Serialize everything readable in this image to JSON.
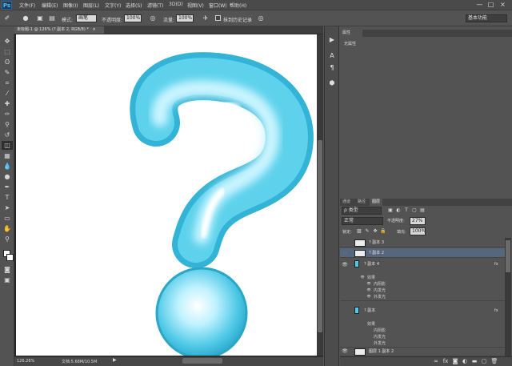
{
  "app": {
    "logo": "Ps"
  },
  "menu": [
    "文件(F)",
    "编辑(E)",
    "图像(I)",
    "图层(L)",
    "文字(Y)",
    "选择(S)",
    "滤镜(T)",
    "3D(D)",
    "视图(V)",
    "窗口(W)",
    "帮助(H)"
  ],
  "window_controls": {
    "minimize": "—",
    "maximize": "□",
    "close": "×"
  },
  "options_bar": {
    "mode_label": "模式:",
    "mode_value": "画笔",
    "opacity_label": "不透明度:",
    "opacity_value": "100%",
    "flow_label": "流量:",
    "flow_value": "100%",
    "erase_history_label": "抹到历史记录",
    "workspace": "基本功能"
  },
  "document": {
    "tab_title": "未标题-1 @ 126% (? 副本 2, RGB/8) *",
    "close": "×"
  },
  "status": {
    "zoom": "126.26%",
    "doc_info": "文档:5.68M/10.5M"
  },
  "properties": {
    "tab": "属性",
    "content": "无属性"
  },
  "layers_panel": {
    "tabs": [
      "通道",
      "路径",
      "图层"
    ],
    "filter_label": "ρ 类型",
    "blend_mode": "正常",
    "opacity_label": "不透明度:",
    "opacity_value": "27%",
    "lock_label": "锁定:",
    "fill_label": "填充:",
    "fill_value": "100%",
    "layers": [
      {
        "name": "? 副本 3",
        "visible": false,
        "selected": false,
        "fx": ""
      },
      {
        "name": "? 副本 2",
        "visible": false,
        "selected": true,
        "fx": ""
      },
      {
        "name": "? 副本 4",
        "visible": true,
        "selected": false,
        "fx": "fx"
      },
      {
        "name": "? 副本",
        "visible": false,
        "selected": false,
        "fx": "fx"
      },
      {
        "name": "图层 1 副本 2",
        "visible": true,
        "selected": false,
        "fx": ""
      }
    ],
    "effects_a": {
      "header": "效果",
      "items": [
        "内阴影",
        "内发光",
        "外发光"
      ]
    },
    "effects_b": {
      "header": "效果",
      "items": [
        "内阴影",
        "内发光",
        "外发光"
      ]
    }
  },
  "colors": {
    "accent": "#3ec3ff",
    "balloon": "#4fc9e6",
    "selected_layer": "#56667c"
  }
}
